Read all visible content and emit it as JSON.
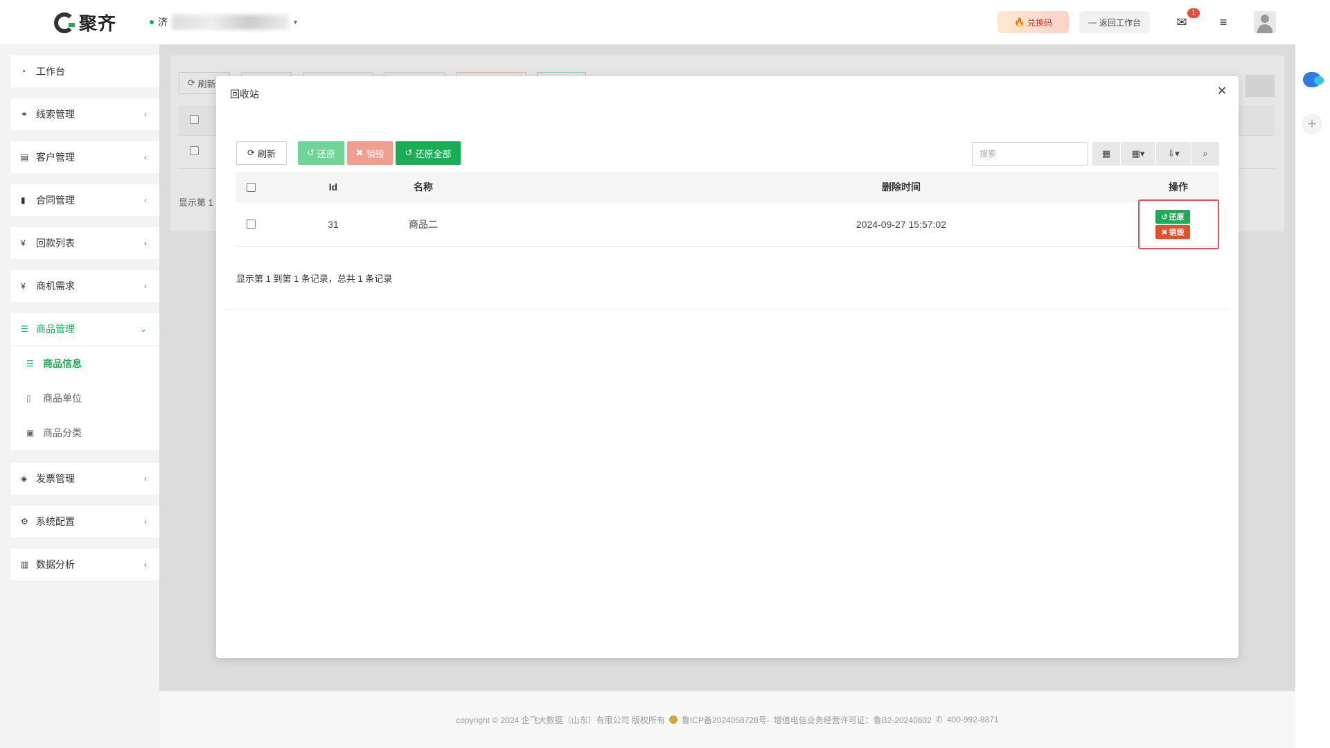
{
  "header": {
    "logo_text": "聚齐",
    "company_name_initial": "济",
    "redeem_label": "兑换码",
    "back_label": "返回工作台",
    "mail_badge": "1",
    "icons": {
      "redeem": "fire-icon",
      "back": "minus-icon",
      "mail": "envelope-icon",
      "menu": "hamburger-icon"
    }
  },
  "sidebar": {
    "items": [
      {
        "label": "工作台",
        "icon": "dashboard-icon"
      },
      {
        "label": "线索管理",
        "icon": "link-icon"
      },
      {
        "label": "客户管理",
        "icon": "id-card-icon"
      },
      {
        "label": "合同管理",
        "icon": "bookmark-icon"
      },
      {
        "label": "回款列表",
        "icon": "yen-icon"
      },
      {
        "label": "商机需求",
        "icon": "yen-icon"
      },
      {
        "label": "商品管理",
        "icon": "list-icon",
        "active": true
      },
      {
        "label": "发票管理",
        "icon": "tag-icon"
      },
      {
        "label": "系统配置",
        "icon": "gears-icon"
      },
      {
        "label": "数据分析",
        "icon": "bar-chart-icon"
      }
    ],
    "sub_items": [
      {
        "label": "商品信息",
        "icon": "list-icon",
        "active": true
      },
      {
        "label": "商品单位",
        "icon": "file-icon"
      },
      {
        "label": "商品分类",
        "icon": "calendar-plus-icon"
      }
    ]
  },
  "background": {
    "refresh_label": "刷新",
    "pager_text": "显示第 1"
  },
  "modal": {
    "title": "回收站",
    "toolbar": {
      "refresh": "刷新",
      "restore": "还原",
      "destroy": "销毁",
      "restore_all": "还原全部",
      "search_placeholder": "搜索"
    },
    "table": {
      "columns": [
        "Id",
        "名称",
        "删除时间",
        "操作"
      ],
      "rows": [
        {
          "id": "31",
          "name": "商品二",
          "deleted_at": "2024-09-27 15:57:02",
          "actions": [
            "还原",
            "销毁"
          ]
        }
      ]
    },
    "pager_text": "显示第 1 到第 1 条记录，总共 1 条记录"
  },
  "footer": {
    "copyright": "copyright © 2024 企飞大数据（山东）有限公司 版权所有",
    "icp": "鲁ICP备2024058728号-",
    "license": "增值电信业务经营许可证：鲁B2-20240602",
    "phone": "400-992-8871"
  },
  "colors": {
    "accent": "#1aad55",
    "danger": "#e2512e",
    "highlight_border": "#e84c5b"
  }
}
